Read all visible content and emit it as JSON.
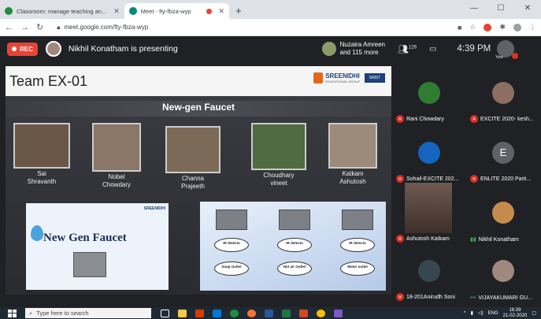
{
  "browser": {
    "tabs": [
      {
        "label": "Classroom: manage teaching an...",
        "favicon_color": "#1e8e3e"
      },
      {
        "label": "Meet - fty-fbza-wyp",
        "favicon_color": "#00897b"
      }
    ],
    "url": "meet.google.com/fty-fbza-wyp"
  },
  "meet": {
    "rec_label": "REC",
    "presenter_text": "Nikhil Konatham is presenting",
    "viewers_line1": "Nuzaira Amreen",
    "viewers_line2": "and 115 more",
    "people_count": "126",
    "time": "4:39 PM",
    "you_label": "You"
  },
  "slide": {
    "team": "Team EX-01",
    "logo_name": "SREENIDHI",
    "logo_sub": "EDUCATIONAL GROUP",
    "logo_badge": "SNIST",
    "title": "New-gen Faucet",
    "members": [
      {
        "name1": "Sai",
        "name2": "Shravanth",
        "color": "#6b5748"
      },
      {
        "name1": "Nobel",
        "name2": "Chowdary",
        "color": "#8a7767"
      },
      {
        "name1": "Channa",
        "name2": "Prajeeth",
        "color": "#7b6a58"
      },
      {
        "name1": "Choudhary",
        "name2": "vineet",
        "color": "#4f6b3f"
      },
      {
        "name1": "Katkam",
        "name2": "Ashutosh",
        "color": "#9c8a7a"
      }
    ],
    "card_logo": "SREENIDHI",
    "card_title": "New Gen Faucet",
    "flow": [
      {
        "step1": "IR detects",
        "step2": "Soap Outlet"
      },
      {
        "step1": "IR detects",
        "step2": "Hot air Outlet"
      },
      {
        "step1": "IR detects",
        "step2": "Water outlet"
      }
    ]
  },
  "participants": [
    {
      "name": "Rani Chowdary",
      "muted": true,
      "color": "#2e7d32"
    },
    {
      "name": "EXCITE 2020- kesh...",
      "muted": true,
      "color": "#8d6e63"
    },
    {
      "name": "Sohail-EXCITE 202...",
      "muted": true,
      "color": "#1565c0"
    },
    {
      "name": "ENLITE 2020 Parti...",
      "muted": true,
      "color": "#5f6368",
      "initial": "E"
    },
    {
      "name": "Ashutosh Katkam",
      "muted": true,
      "color": "#6d5b52"
    },
    {
      "name": "Nikhil Konatham",
      "muted": false,
      "color": "#c58b4c"
    },
    {
      "name": "18-201Anirudh Soni",
      "muted": true,
      "color": "#37474f"
    },
    {
      "name": "VIJAYAKUMARI GU...",
      "muted": false,
      "color": "#a1887f"
    }
  ],
  "taskbar": {
    "search_placeholder": "Type here to search",
    "clock_time": "16:39",
    "clock_date": "21-02-2020",
    "lang": "ENG"
  }
}
